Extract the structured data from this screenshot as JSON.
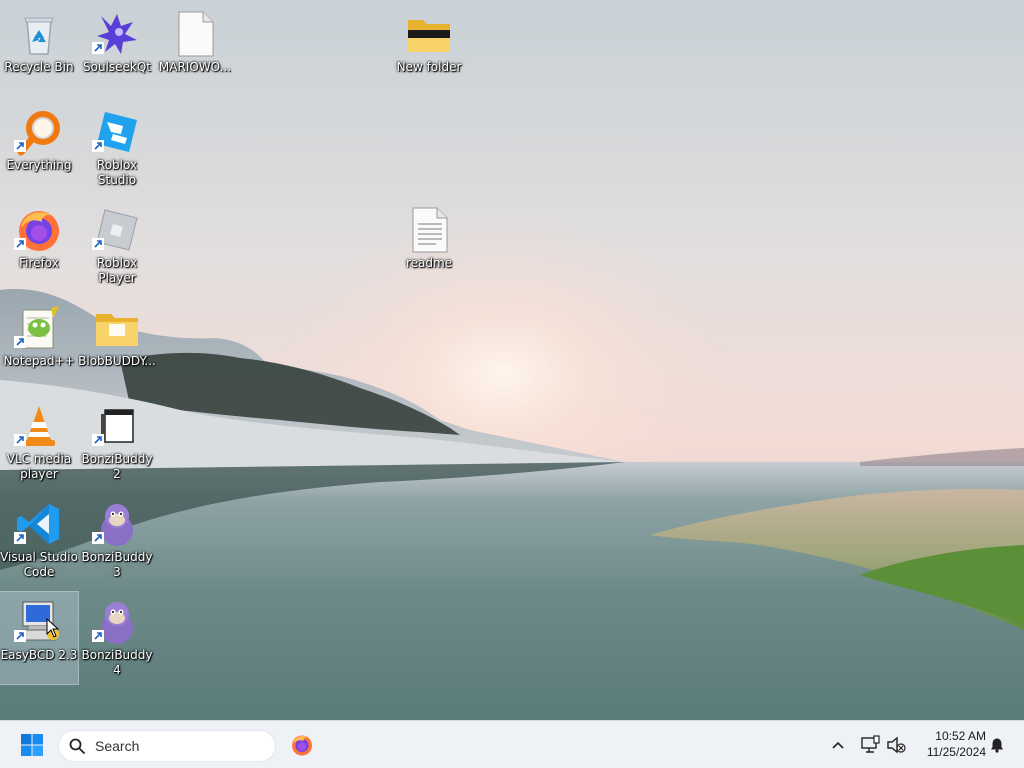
{
  "desktop": {
    "icons": [
      {
        "label": "Recycle Bin",
        "icon": "recycle-bin-icon",
        "shortcut": false
      },
      {
        "label": "SoulseekQt",
        "icon": "soulseek-icon",
        "shortcut": true
      },
      {
        "label": "MARIOWO...",
        "icon": "blank-file-icon",
        "shortcut": false
      },
      {
        "label": "New folder",
        "icon": "folder-icon",
        "shortcut": false
      },
      {
        "label": "Everything",
        "icon": "everything-search-icon",
        "shortcut": true
      },
      {
        "label": "Roblox Studio",
        "icon": "roblox-studio-icon",
        "shortcut": true
      },
      {
        "label": "Firefox",
        "icon": "firefox-icon",
        "shortcut": true
      },
      {
        "label": "Roblox Player",
        "icon": "roblox-player-icon",
        "shortcut": true
      },
      {
        "label": "readme",
        "icon": "text-file-icon",
        "shortcut": false
      },
      {
        "label": "Notepad++",
        "icon": "notepadpp-icon",
        "shortcut": true
      },
      {
        "label": "BlobBUDDY...",
        "icon": "folder-icon",
        "shortcut": false
      },
      {
        "label": "VLC media player",
        "icon": "vlc-icon",
        "shortcut": true
      },
      {
        "label": "BonziBuddy2",
        "icon": "window-app-icon",
        "shortcut": true
      },
      {
        "label": "Visual Studio Code",
        "icon": "vscode-icon",
        "shortcut": true
      },
      {
        "label": "BonziBuddy3",
        "icon": "bonzibuddy-icon",
        "shortcut": true
      },
      {
        "label": "EasyBCD 2.3",
        "icon": "easybcd-icon",
        "shortcut": true
      },
      {
        "label": "BonziBuddy4",
        "icon": "bonzibuddy-icon",
        "shortcut": true
      }
    ],
    "selected_icon": "EasyBCD 2.3"
  },
  "taskbar": {
    "start_icon": "windows-start-icon",
    "search_placeholder": "Search",
    "pinned": [
      {
        "name": "Firefox",
        "icon": "firefox-icon"
      }
    ],
    "tray": {
      "icons": [
        "chevron-up-icon",
        "network-icon",
        "volume-muted-icon",
        "notification-bell-icon"
      ],
      "time": "10:52 AM",
      "date": "11/25/2024"
    }
  },
  "colors": {
    "accent": "#0078d4",
    "taskbar_bg": "#eef1f5",
    "sky_top": "#cfd6da",
    "sky_horizon": "#f3dcd4",
    "water": "#5f7d7a"
  }
}
